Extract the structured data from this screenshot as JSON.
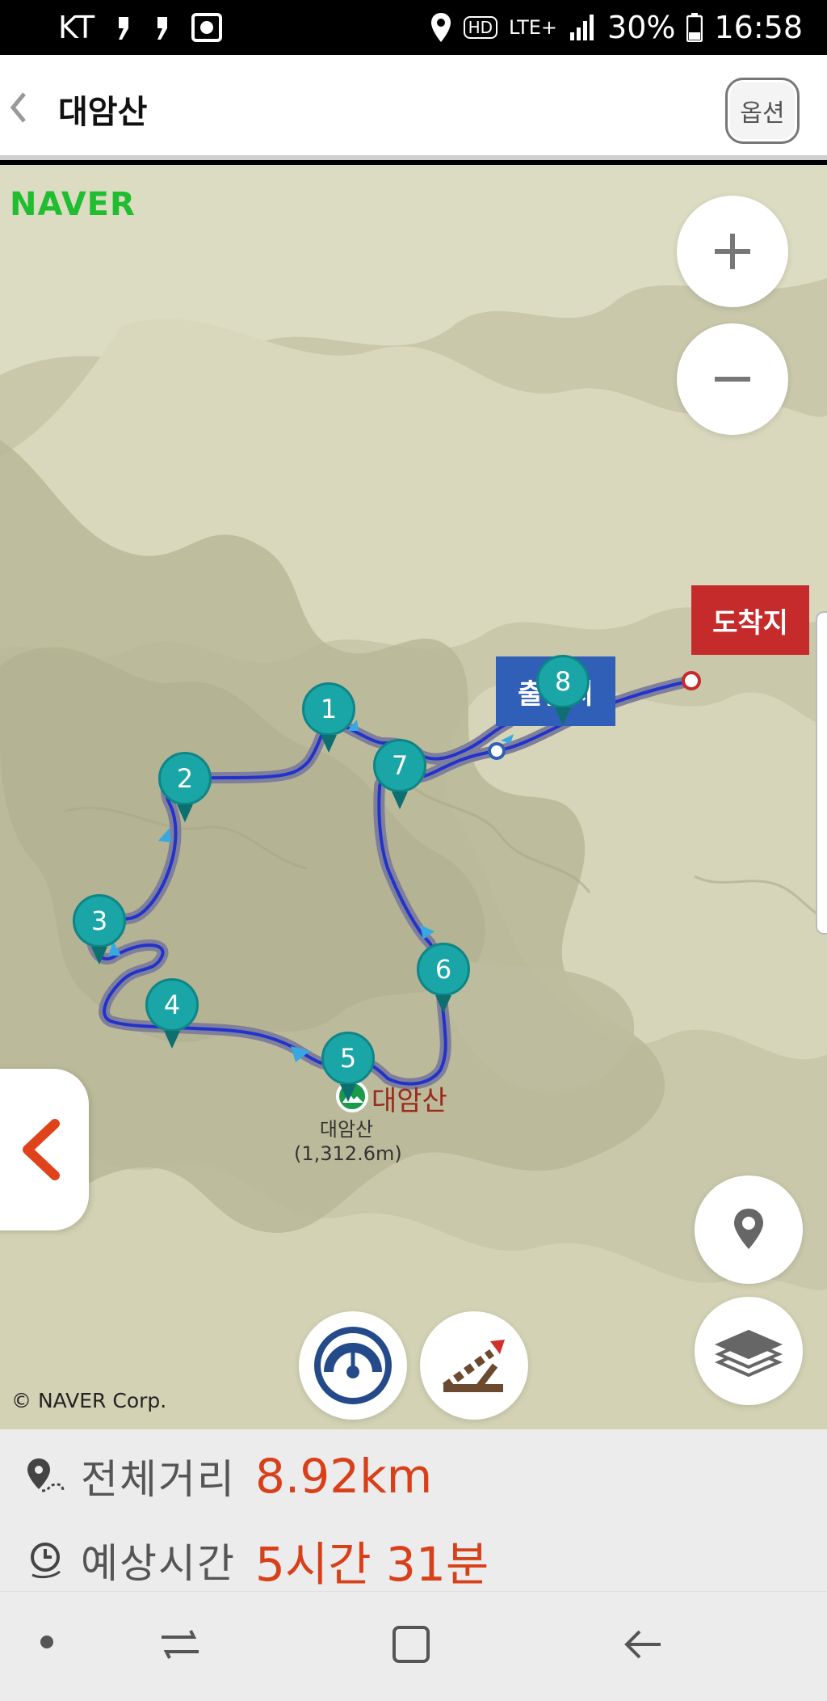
{
  "status_bar": {
    "carrier": "KT",
    "battery": "30%",
    "time": "16:58",
    "network": "LTE+",
    "hd": "HD",
    "icons": [
      "notification-icon",
      "notification-icon",
      "record-icon",
      "location-icon",
      "hd-voice-icon",
      "lte-icon",
      "signal-icon",
      "battery-icon"
    ]
  },
  "header": {
    "title": "대암산",
    "options_label": "옵션"
  },
  "map": {
    "logo": "NAVER",
    "copyright": "© NAVER Corp.",
    "start_label": "출발지",
    "end_label": "도착지",
    "peak_label": "대암산",
    "peak_name": "대암산",
    "peak_elevation": "(1,312.6m)",
    "waypoints": [
      "1",
      "2",
      "3",
      "4",
      "5",
      "6",
      "7",
      "8"
    ],
    "route_color": "#2233cc",
    "route_outline": "#8a8aa0"
  },
  "summary": {
    "distance_label": "전체거리",
    "distance_value": "8.92km",
    "time_label": "예상시간",
    "time_value": "5시간 31분"
  },
  "colors": {
    "accent": "#d8401a",
    "waypoint": "#1aa5a6",
    "start_flag": "#2f5fb6",
    "end_flag": "#c62b2b",
    "naver": "#1fbd2f"
  }
}
